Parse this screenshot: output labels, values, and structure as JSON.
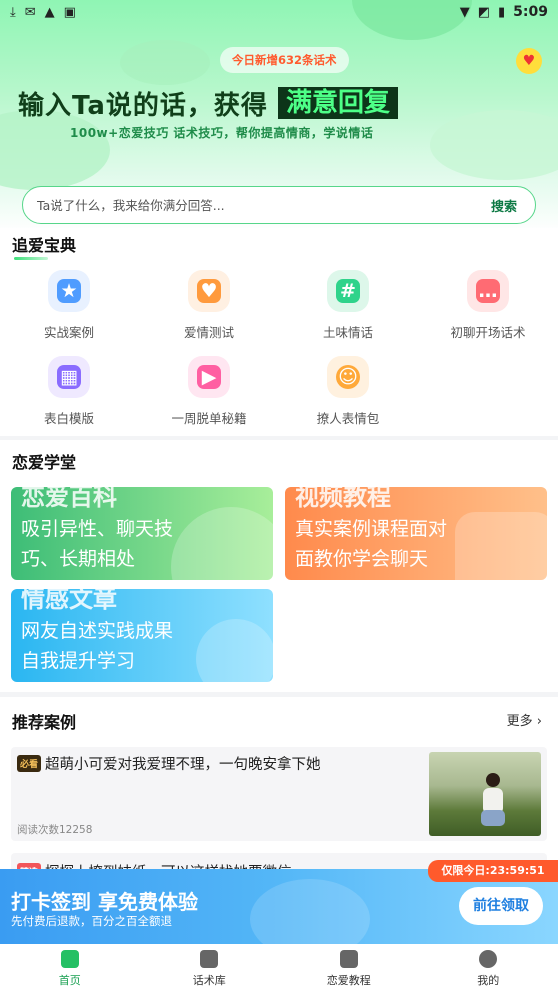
{
  "status_bar": {
    "time": "5:09"
  },
  "hero": {
    "badge": "今日新增632条话术",
    "headline_main": "输入Ta说的话，获得",
    "headline_highlight": "满意回复",
    "subline": "100w+恋爱技巧 话术技巧，帮你提高情商，学说情话"
  },
  "search": {
    "placeholder": "Ta说了什么，我来给你满分回答...",
    "button": "搜索"
  },
  "section_treasure": {
    "title": "追爱宝典",
    "items": [
      {
        "label": "实战案例",
        "icon": "star-bookmark-icon",
        "color": "#5aa7ff"
      },
      {
        "label": "爱情测试",
        "icon": "heart-icon",
        "color": "#ff9a3d"
      },
      {
        "label": "土味情话",
        "icon": "hashtag-icon",
        "color": "#2fd38b"
      },
      {
        "label": "初聊开场话术",
        "icon": "chat-bubble-icon",
        "color": "#ff6b73"
      },
      {
        "label": "表白模版",
        "icon": "grid-icon",
        "color": "#8a6cff"
      },
      {
        "label": "一周脱单秘籍",
        "icon": "video-icon",
        "color": "#ff5fa2"
      },
      {
        "label": "撩人表情包",
        "icon": "smile-icon",
        "color": "#ffa93a"
      }
    ]
  },
  "section_school": {
    "title": "恋爱学堂",
    "cards": [
      {
        "title": "恋爱百科",
        "desc_line1": "吸引异性、聊天技",
        "desc_line2": "巧、长期相处"
      },
      {
        "title": "视频教程",
        "desc_line1": "真实案例课程面对",
        "desc_line2": "面教你学会聊天"
      },
      {
        "title": "情感文章",
        "desc_line1": "网友自述实践成果",
        "desc_line2": "自我提升学习"
      }
    ]
  },
  "section_cases": {
    "title": "推荐案例",
    "more": "更多",
    "items": [
      {
        "tag": "必看",
        "title": "超萌小可爱对我爱理不理，一句晚安拿下她",
        "reads": "阅读次数12258"
      },
      {
        "tag": "精选",
        "title": "探探上撩到妹纸，可以这样找她要微信"
      }
    ]
  },
  "banner": {
    "title": "打卡签到 享免费体验",
    "subtitle": "先付费后退款，百分之百全额退",
    "button": "前往领取",
    "timer": "仅限今日:23:59:51"
  },
  "tabbar": [
    {
      "label": "首页",
      "icon": "home-icon"
    },
    {
      "label": "话术库",
      "icon": "lightning-icon"
    },
    {
      "label": "恋爱教程",
      "icon": "book-icon"
    },
    {
      "label": "我的",
      "icon": "user-icon"
    }
  ]
}
